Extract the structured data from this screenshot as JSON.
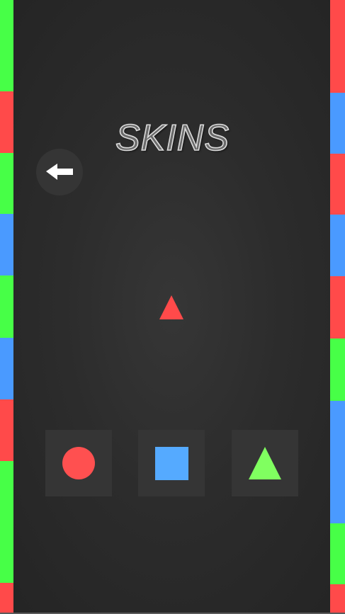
{
  "screen": {
    "title": "SKINS",
    "background": "#2c2c2c"
  },
  "back_button": {
    "icon": "arrow-left-icon",
    "background": "#353535",
    "icon_color": "#ffffff"
  },
  "preview": {
    "shape": "triangle",
    "color": "#ff4a4a"
  },
  "skins": [
    {
      "shape": "circle",
      "color": "#ff5050",
      "icon": "circle-icon"
    },
    {
      "shape": "square",
      "color": "#55aaff",
      "icon": "square-icon"
    },
    {
      "shape": "triangle",
      "color": "#80ff60",
      "icon": "triangle-icon"
    }
  ],
  "colors": {
    "red": "#ff4a4a",
    "green": "#47ff47",
    "blue": "#4a9aff"
  },
  "left_stripe": [
    "green",
    "red",
    "green",
    "blue",
    "green",
    "blue",
    "red",
    "green",
    "red"
  ],
  "right_stripe": [
    "red",
    "blue",
    "red",
    "blue",
    "red",
    "green",
    "blue",
    "green",
    "red"
  ]
}
